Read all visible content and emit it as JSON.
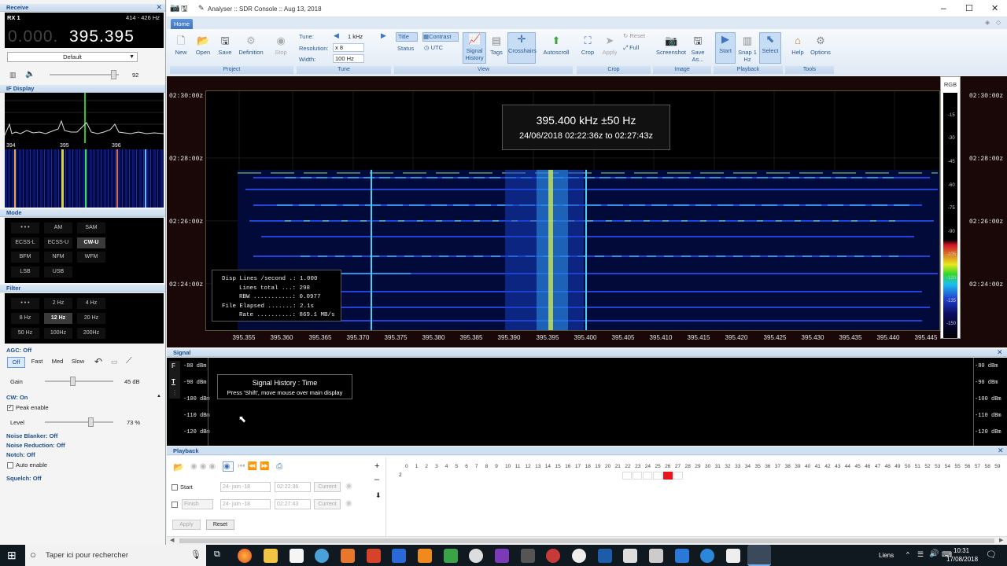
{
  "receive": {
    "title": "Receive",
    "rx_label": "RX 1",
    "range": "414 - 426 Hz",
    "freq_dim": "0.000.",
    "freq_main": "395.395",
    "preset": "Default",
    "volume_value": "92",
    "if_display_label": "IF Display",
    "if_ticks": [
      "394",
      "395",
      "396"
    ]
  },
  "mode": {
    "label": "Mode",
    "items": [
      "• • •",
      "AM",
      "SAM",
      "ECSS-L",
      "ECSS-U",
      "CW-U",
      "BFM",
      "NFM",
      "WFM",
      "LSB",
      "USB"
    ],
    "selected": "CW-U"
  },
  "filter": {
    "label": "Filter",
    "items": [
      "• • •",
      "2 Hz",
      "4 Hz",
      "8 Hz",
      "12 Hz",
      "20 Hz",
      "50 Hz",
      "100Hz",
      "200Hz"
    ],
    "selected": "12 Hz"
  },
  "agc": {
    "label": "AGC: Off",
    "buttons": [
      "Off",
      "Fast",
      "Med",
      "Slow"
    ],
    "gain_label": "Gain",
    "gain_value": "45 dB"
  },
  "cw": {
    "label": "CW: On",
    "peak_enable": "Peak enable",
    "level_label": "Level",
    "level_value": "73 %"
  },
  "sections": {
    "noise_blanker": "Noise Blanker: Off",
    "noise_reduction": "Noise Reduction: Off",
    "notch": "Notch: Off",
    "auto_enable": "Auto enable",
    "squelch": "Squelch: Off"
  },
  "window": {
    "title": "Analyser :: SDR Console :: Aug 13, 2018",
    "tab_home": "Home"
  },
  "ribbon": {
    "project": [
      "New",
      "Open",
      "Save",
      "Definition",
      "Stop"
    ],
    "project_label": "Project",
    "tune_label": "Tune:",
    "tune_value": "1 kHz",
    "resolution_label": "Resolution:",
    "resolution_value": "x 8",
    "width_label": "Width:",
    "width_value": "100 Hz",
    "tune_group": "Tune",
    "title_btn": "Title",
    "status_btn": "Status",
    "contrast_btn": "Contrast",
    "utc_btn": "UTC",
    "view_btns": [
      "Signal History",
      "Tags",
      "Crosshairs",
      "Autoscroll"
    ],
    "view_label": "View",
    "crop_btns": [
      "Crop",
      "Apply"
    ],
    "reset_btn": "Reset",
    "full_btn": "Full",
    "crop_label": "Crop",
    "image_btns": [
      "Screenshot",
      "Save As..."
    ],
    "image_label": "Image",
    "playback_btns": [
      "Start",
      "Snap 1 Hz",
      "Select"
    ],
    "playback_label": "Playback",
    "tools_btns": [
      "Help",
      "Options"
    ],
    "tools_label": "Tools"
  },
  "spectrogram": {
    "time_labels": [
      "02:30:00z",
      "02:28:00z",
      "02:26:00z",
      "02:24:00z"
    ],
    "freq_ticks": [
      "395.355",
      "395.360",
      "395.365",
      "395.370",
      "395.375",
      "395.380",
      "395.385",
      "395.390",
      "395.395",
      "395.400",
      "395.405",
      "395.410",
      "395.415",
      "395.420",
      "395.425",
      "395.430",
      "395.435",
      "395.440",
      "395.445"
    ],
    "info_freq": "395.400 kHz ±50 Hz",
    "info_time": "24/06/2018 02:22:36z to 02:27:43z",
    "stats": [
      [
        "Disp Lines /second .:",
        "1.000"
      ],
      [
        "Lines total ...:",
        "298"
      ],
      [
        "RBW ...........:",
        "0.0977"
      ],
      [
        "File Elapsed .......:",
        "2.1s"
      ],
      [
        "Rate ..........:",
        "869.1 MB/s"
      ]
    ],
    "scale_label": "RGB",
    "scale_ticks": [
      "-15",
      "-30",
      "-45",
      "-60",
      "-75",
      "-90",
      "-105",
      "-120",
      "-135",
      "-150"
    ]
  },
  "signal": {
    "title": "Signal",
    "db_labels": [
      "-80 dBm",
      "-90 dBm",
      "-100 dBm",
      "-110 dBm",
      "-120 dBm"
    ],
    "tip_title": "Signal History : Time",
    "tip_text": "Press 'Shift', move mouse over main display"
  },
  "playback": {
    "title": "Playback",
    "start_label": "Start",
    "finish_label": "Finish",
    "start_date": "24- juin -18",
    "start_time": "02:22:36",
    "finish_date": "24- juin -18",
    "finish_time": "02:27:43",
    "current_label": "Current",
    "apply_label": "Apply",
    "reset_label": "Reset",
    "minutes": [
      "0",
      "1",
      "2",
      "3",
      "4",
      "5",
      "6",
      "7",
      "8",
      "9",
      "10",
      "11",
      "12",
      "13",
      "14",
      "15",
      "16",
      "17",
      "18",
      "19",
      "20",
      "21",
      "22",
      "23",
      "24",
      "25",
      "26",
      "27",
      "28",
      "29",
      "30",
      "31",
      "32",
      "33",
      "34",
      "35",
      "36",
      "37",
      "38",
      "39",
      "40",
      "41",
      "42",
      "43",
      "44",
      "45",
      "46",
      "47",
      "48",
      "49",
      "50",
      "51",
      "52",
      "53",
      "54",
      "55",
      "56",
      "57",
      "58",
      "59"
    ],
    "row_hour": "2"
  },
  "taskbar": {
    "search_placeholder": "Taper ici pour rechercher",
    "links": "Liens",
    "time": "10:31",
    "date": "17/08/2018"
  }
}
